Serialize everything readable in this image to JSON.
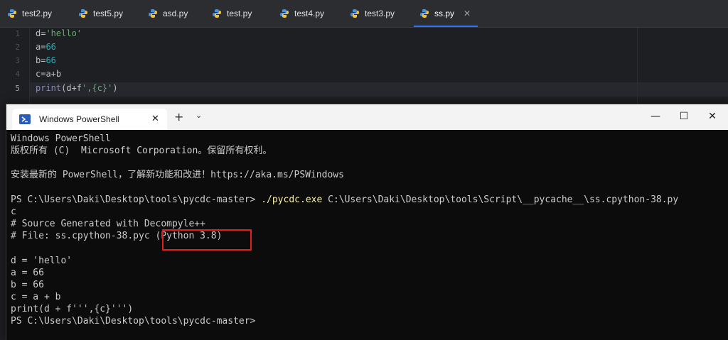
{
  "editor": {
    "tabs": [
      {
        "label": "test2.py",
        "active": false
      },
      {
        "label": "test5.py",
        "active": false
      },
      {
        "label": "asd.py",
        "active": false
      },
      {
        "label": "test.py",
        "active": false
      },
      {
        "label": "test4.py",
        "active": false
      },
      {
        "label": "test3.py",
        "active": false
      },
      {
        "label": "ss.py",
        "active": true
      }
    ],
    "close_glyph": "✕",
    "line_numbers": [
      "1",
      "2",
      "3",
      "4",
      "5"
    ],
    "code": {
      "l1": {
        "a": "d=",
        "b": "'hello'"
      },
      "l2": {
        "a": "a=",
        "b": "66"
      },
      "l3": {
        "a": "b=",
        "b": "66"
      },
      "l4": {
        "a": "c=a+b"
      },
      "l5": {
        "fn": "print",
        "a": "(d+f",
        "b": "',{c}'",
        "c": ")"
      }
    }
  },
  "powershell": {
    "tab_title": "Windows PowerShell",
    "tab_close": "✕",
    "new_tab": "+",
    "dropdown": "⌄",
    "minimize": "—",
    "maximize": "☐",
    "close": "✕",
    "lines": {
      "l1": "Windows PowerShell",
      "l2": "版权所有 (C)  Microsoft Corporation。保留所有权利。",
      "l3": "安装最新的 PowerShell，了解新功能和改进！https://aka.ms/PSWindows",
      "prompt1": "PS C:\\Users\\Daki\\Desktop\\tools\\pycdc-master> ",
      "cmd_exe": "./pycdc.exe",
      "cmd_arg": " C:\\Users\\Daki\\Desktop\\tools\\Script\\__pycache__\\ss.cpython-38.py",
      "l5": "c",
      "l6": "# Source Generated with Decompyle++",
      "l7": "# File: ss.cpython-38.pyc (Python 3.8)",
      "l8": "d = 'hello'",
      "l9": "a = 66",
      "l10": "b = 66",
      "l11": "c = a + b",
      "l12": "print(d + f''',{c}''')",
      "l13": "PS C:\\Users\\Daki\\Desktop\\tools\\pycdc-master>"
    }
  },
  "colors": {
    "editor_bg": "#1e1f22",
    "terminal_bg": "#0c0c0c",
    "accent": "#3574f0",
    "highlight_box": "#e02020"
  }
}
